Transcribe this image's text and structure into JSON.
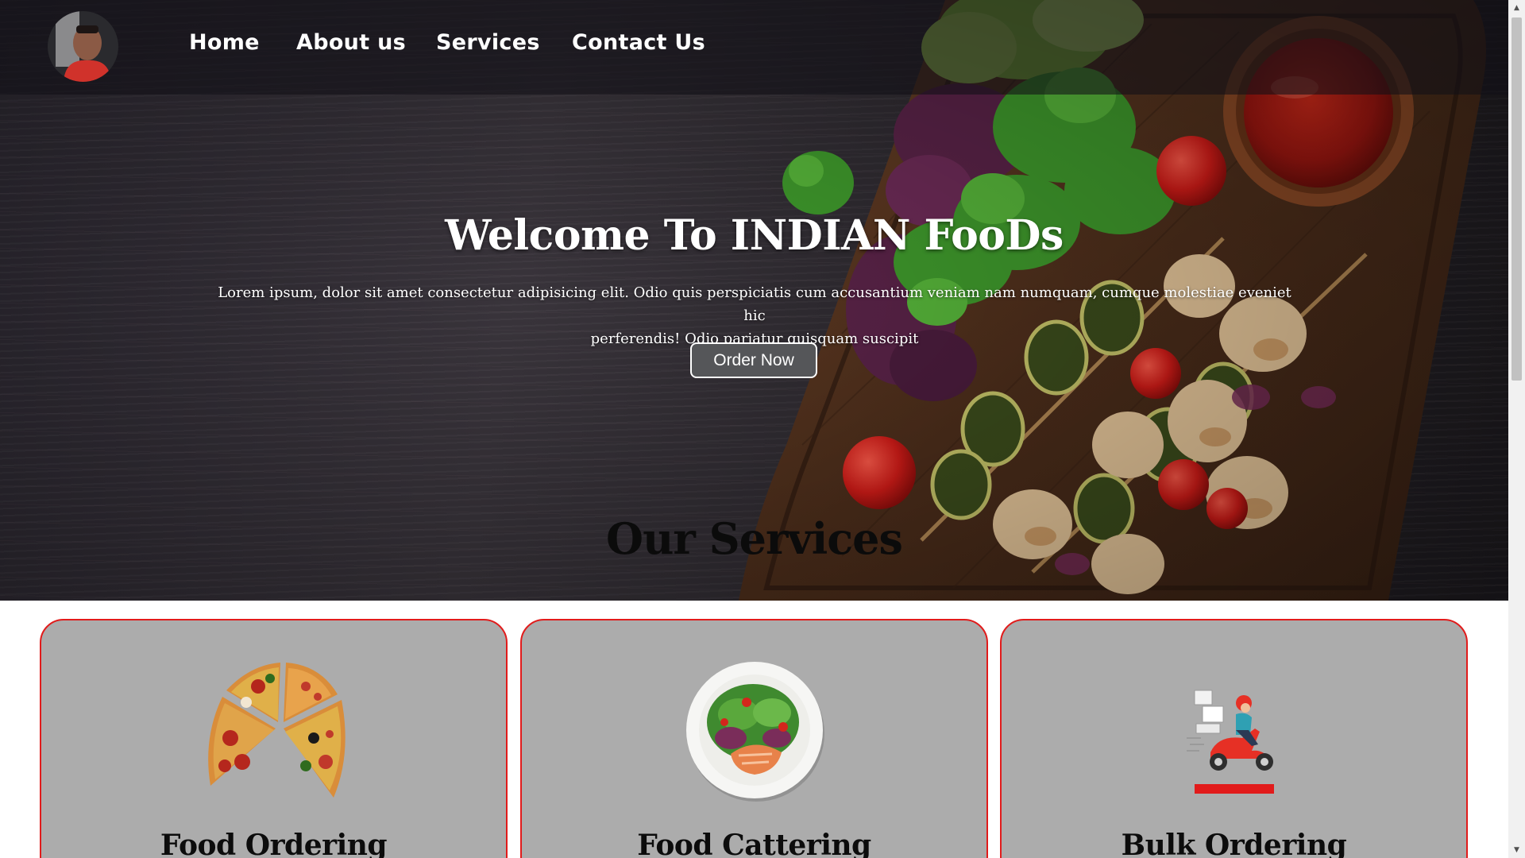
{
  "nav": {
    "avatar_alt": "profile photo",
    "links": [
      {
        "label": "Home"
      },
      {
        "label": "About us"
      },
      {
        "label": "Services"
      },
      {
        "label": "Contact Us"
      }
    ]
  },
  "hero": {
    "title": "Welcome To INDIAN FooDs",
    "description_line1": "Lorem ipsum, dolor sit amet consectetur adipisicing elit. Odio quis perspiciatis cum accusantium veniam nam numquam, cumque molestiae eveniet hic",
    "description_line2": "perferendis! Odio pariatur quisquam suscipit",
    "cta_label": "Order Now"
  },
  "services": {
    "heading": "Our Services",
    "cards": [
      {
        "title": "Food Ordering",
        "icon": "pizza-icon"
      },
      {
        "title": "Food Cattering",
        "icon": "salad-plate-icon"
      },
      {
        "title": "Bulk Ordering",
        "icon": "delivery-scooter-icon"
      }
    ]
  },
  "colors": {
    "card_border": "#e11b1b",
    "card_background": "#acacac",
    "navbar_background": "rgba(18,16,22,0.58)"
  }
}
